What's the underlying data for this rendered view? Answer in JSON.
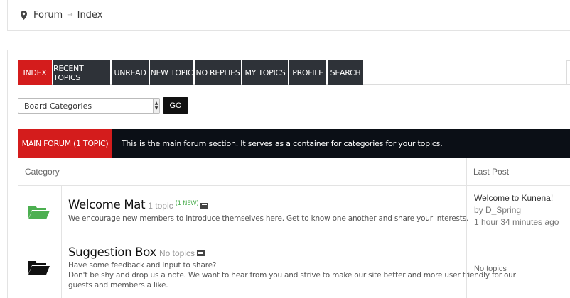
{
  "breadcrumb": {
    "items": [
      "Forum",
      "Index"
    ]
  },
  "tabs": [
    {
      "label": "INDEX",
      "active": true
    },
    {
      "label": "RECENT TOPICS",
      "active": false
    },
    {
      "label": "UNREAD",
      "active": false
    },
    {
      "label": "NEW TOPIC",
      "active": false
    },
    {
      "label": "NO REPLIES",
      "active": false
    },
    {
      "label": "MY TOPICS",
      "active": false
    },
    {
      "label": "PROFILE",
      "active": false
    },
    {
      "label": "SEARCH",
      "active": false
    }
  ],
  "board_select": {
    "value": "Board Categories"
  },
  "go_button": {
    "label": "GO"
  },
  "section": {
    "title": "MAIN FORUM (1 TOPIC)",
    "description": "This is the main forum section. It serves as a container for categories for your topics."
  },
  "table": {
    "category_header": "Category",
    "last_post_header": "Last Post"
  },
  "categories": [
    {
      "title": "Welcome Mat",
      "count": "1 topic",
      "badge": "(1 NEW)",
      "description": "We encourage new members to introduce themselves here. Get to know one another and share your interests.",
      "folder_color": "#4caf50",
      "last_post": {
        "title": "Welcome to Kunena!",
        "by": "by D_Spring",
        "when": "1 hour 34 minutes ago"
      }
    },
    {
      "title": "Suggestion Box",
      "count": "No topics",
      "description_lines": [
        "Have some feedback and input to share?",
        "Don't be shy and drop us a note. We want to hear from you and strive to make our site better and more user friendly for our",
        "guests and members a like."
      ],
      "folder_color": "#111111",
      "last_post": {
        "text": "No topics"
      }
    }
  ],
  "colors": {
    "accent": "#d41c1c",
    "dark": "#2e3238",
    "new": "#4caf50"
  }
}
